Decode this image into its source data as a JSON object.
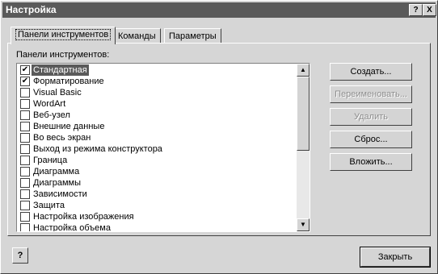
{
  "window": {
    "title": "Настройка",
    "help_btn": "?",
    "close_btn": "X"
  },
  "tabs": [
    {
      "label": "Панели инструментов"
    },
    {
      "label": "Команды"
    },
    {
      "label": "Параметры"
    }
  ],
  "toolbars": {
    "label": "Панели инструментов:",
    "items": [
      {
        "label": "Стандартная",
        "checked": true,
        "selected": true
      },
      {
        "label": "Форматирование",
        "checked": true
      },
      {
        "label": "Visual Basic",
        "checked": false
      },
      {
        "label": "WordArt",
        "checked": false
      },
      {
        "label": "Веб-узел",
        "checked": false
      },
      {
        "label": "Внешние данные",
        "checked": false
      },
      {
        "label": "Во весь экран",
        "checked": false
      },
      {
        "label": "Выход из режима конструктора",
        "checked": false
      },
      {
        "label": "Граница",
        "checked": false
      },
      {
        "label": "Диаграмма",
        "checked": false
      },
      {
        "label": "Диаграммы",
        "checked": false
      },
      {
        "label": "Зависимости",
        "checked": false
      },
      {
        "label": "Защита",
        "checked": false
      },
      {
        "label": "Настройка изображения",
        "checked": false
      },
      {
        "label": "Настройка объема",
        "checked": false
      }
    ]
  },
  "buttons": {
    "create": "Создать...",
    "rename": "Переименовать...",
    "delete": "Удалить",
    "reset": "Сброс...",
    "attach": "Вложить..."
  },
  "footer": {
    "help_icon": "?",
    "close": "Закрыть"
  }
}
